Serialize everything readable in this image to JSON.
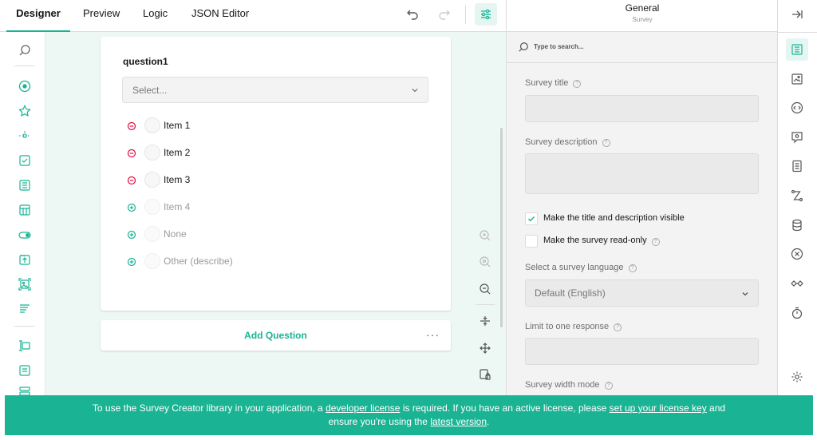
{
  "tabs": [
    {
      "label": "Designer",
      "active": true
    },
    {
      "label": "Preview",
      "active": false
    },
    {
      "label": "Logic",
      "active": false
    },
    {
      "label": "JSON Editor",
      "active": false
    }
  ],
  "toolbar_icons": [
    "undo-icon",
    "redo-icon",
    "settings-sliders-icon"
  ],
  "question": {
    "title": "question1",
    "placeholder": "Select...",
    "choices": [
      {
        "label": "Item 1",
        "action": "remove"
      },
      {
        "label": "Item 2",
        "action": "remove"
      },
      {
        "label": "Item 3",
        "action": "remove"
      },
      {
        "label": "Item 4",
        "action": "add"
      },
      {
        "label": "None",
        "action": "add"
      },
      {
        "label": "Other (describe)",
        "action": "add"
      }
    ]
  },
  "add_question_label": "Add Question",
  "more_label": "···",
  "panel": {
    "title": "General",
    "subtitle": "Survey",
    "search_placeholder": "Type to search...",
    "survey_title_label": "Survey title",
    "survey_description_label": "Survey description",
    "title_visible_label": "Make the title and description visible",
    "read_only_label": "Make the survey read-only",
    "language_label": "Select a survey language",
    "language_value": "Default (English)",
    "limit_label": "Limit to one response",
    "width_mode_label": "Survey width mode"
  },
  "banner": {
    "part1": "To use the Survey Creator library in your application, a ",
    "link1": "developer license",
    "part2": " is required. If you have an active license, please ",
    "link2": "set up your license key",
    "part3": " and",
    "part4": "ensure you're using the ",
    "link3": "latest version",
    "part5": "."
  },
  "colors": {
    "accent": "#19b394",
    "remove": "#e60a3e",
    "banner": "#1ab394",
    "canvas": "#edf8f5"
  }
}
